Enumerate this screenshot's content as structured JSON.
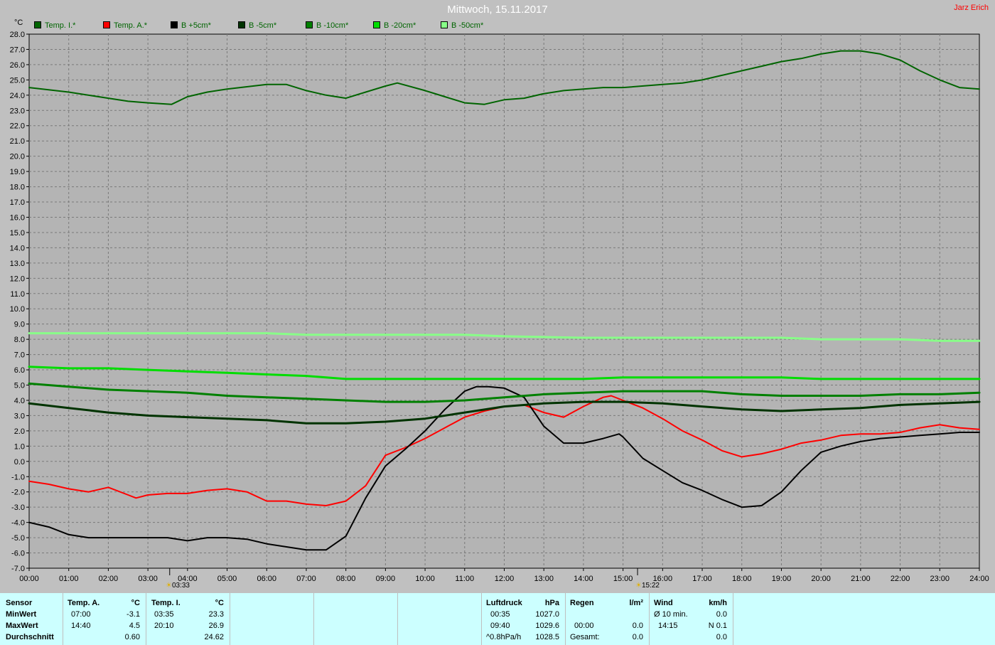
{
  "title": "Mittwoch, 15.11.2017",
  "author": "Jarz Erich",
  "unit_label": "°C",
  "legend": [
    {
      "label": "Temp. I.*",
      "color": "#006400"
    },
    {
      "label": "Temp. A.*",
      "color": "#ff0000"
    },
    {
      "label": "B +5cm*",
      "color": "#000000"
    },
    {
      "label": "B -5cm*",
      "color": "#003300"
    },
    {
      "label": "B -10cm*",
      "color": "#008000"
    },
    {
      "label": "B -20cm*",
      "color": "#00dd00"
    },
    {
      "label": "B -50cm*",
      "color": "#88ff88"
    }
  ],
  "sunrise": "03:33",
  "sunset": "15:22",
  "chart_data": {
    "type": "line",
    "title": "Mittwoch, 15.11.2017",
    "ylabel": "°C",
    "ylim": [
      -7.0,
      28.0
    ],
    "ytick_step": 1.0,
    "xlim": [
      0,
      24
    ],
    "x_ticks": [
      "00:00",
      "01:00",
      "02:00",
      "03:00",
      "04:00",
      "05:00",
      "06:00",
      "07:00",
      "08:00",
      "09:00",
      "10:00",
      "11:00",
      "12:00",
      "13:00",
      "14:00",
      "15:00",
      "16:00",
      "17:00",
      "18:00",
      "19:00",
      "20:00",
      "21:00",
      "22:00",
      "23:00",
      "24:00"
    ],
    "grid": true,
    "legend_position": "top-left",
    "series": [
      {
        "name": "Temp. I.*",
        "color": "#006400",
        "width": 2,
        "points": [
          [
            0,
            24.5
          ],
          [
            1,
            24.2
          ],
          [
            2,
            23.8
          ],
          [
            2.5,
            23.6
          ],
          [
            3,
            23.5
          ],
          [
            3.6,
            23.4
          ],
          [
            4,
            23.9
          ],
          [
            4.5,
            24.2
          ],
          [
            5,
            24.4
          ],
          [
            6,
            24.7
          ],
          [
            6.5,
            24.7
          ],
          [
            7,
            24.3
          ],
          [
            7.5,
            24.0
          ],
          [
            8,
            23.8
          ],
          [
            8.5,
            24.2
          ],
          [
            9,
            24.6
          ],
          [
            9.3,
            24.8
          ],
          [
            10,
            24.3
          ],
          [
            10.5,
            23.9
          ],
          [
            11,
            23.5
          ],
          [
            11.5,
            23.4
          ],
          [
            12,
            23.7
          ],
          [
            12.5,
            23.8
          ],
          [
            13,
            24.1
          ],
          [
            13.5,
            24.3
          ],
          [
            14,
            24.4
          ],
          [
            14.5,
            24.5
          ],
          [
            15,
            24.5
          ],
          [
            16,
            24.7
          ],
          [
            16.5,
            24.8
          ],
          [
            17,
            25.0
          ],
          [
            17.5,
            25.3
          ],
          [
            18,
            25.6
          ],
          [
            18.5,
            25.9
          ],
          [
            19,
            26.2
          ],
          [
            19.5,
            26.4
          ],
          [
            20,
            26.7
          ],
          [
            20.5,
            26.9
          ],
          [
            21,
            26.9
          ],
          [
            21.5,
            26.7
          ],
          [
            22,
            26.3
          ],
          [
            22.5,
            25.6
          ],
          [
            23,
            25.0
          ],
          [
            23.5,
            24.5
          ],
          [
            24,
            24.4
          ]
        ]
      },
      {
        "name": "Temp. A.*",
        "color": "#ff0000",
        "width": 2,
        "points": [
          [
            0,
            -1.3
          ],
          [
            0.5,
            -1.5
          ],
          [
            1,
            -1.8
          ],
          [
            1.5,
            -2.0
          ],
          [
            2,
            -1.7
          ],
          [
            2.5,
            -2.2
          ],
          [
            2.7,
            -2.4
          ],
          [
            3,
            -2.2
          ],
          [
            3.5,
            -2.1
          ],
          [
            4,
            -2.1
          ],
          [
            4.5,
            -1.9
          ],
          [
            5,
            -1.8
          ],
          [
            5.5,
            -2.0
          ],
          [
            6,
            -2.6
          ],
          [
            6.5,
            -2.6
          ],
          [
            7,
            -2.8
          ],
          [
            7.5,
            -2.9
          ],
          [
            8,
            -2.6
          ],
          [
            8.5,
            -1.6
          ],
          [
            9,
            0.4
          ],
          [
            9.5,
            0.9
          ],
          [
            10,
            1.5
          ],
          [
            10.5,
            2.2
          ],
          [
            11,
            2.9
          ],
          [
            11.5,
            3.3
          ],
          [
            12,
            3.6
          ],
          [
            12.5,
            3.7
          ],
          [
            13,
            3.2
          ],
          [
            13.5,
            2.9
          ],
          [
            14,
            3.6
          ],
          [
            14.5,
            4.2
          ],
          [
            14.7,
            4.3
          ],
          [
            15,
            4.0
          ],
          [
            15.5,
            3.5
          ],
          [
            16,
            2.8
          ],
          [
            16.5,
            2.0
          ],
          [
            17,
            1.4
          ],
          [
            17.5,
            0.7
          ],
          [
            18,
            0.3
          ],
          [
            18.5,
            0.5
          ],
          [
            19,
            0.8
          ],
          [
            19.5,
            1.2
          ],
          [
            20,
            1.4
          ],
          [
            20.5,
            1.7
          ],
          [
            21,
            1.8
          ],
          [
            21.5,
            1.8
          ],
          [
            22,
            1.9
          ],
          [
            22.5,
            2.2
          ],
          [
            23,
            2.4
          ],
          [
            23.5,
            2.2
          ],
          [
            24,
            2.1
          ]
        ]
      },
      {
        "name": "B +5cm*",
        "color": "#000000",
        "width": 2,
        "points": [
          [
            0,
            -4.0
          ],
          [
            0.5,
            -4.3
          ],
          [
            1,
            -4.8
          ],
          [
            1.5,
            -5.0
          ],
          [
            2,
            -5.0
          ],
          [
            2.5,
            -5.0
          ],
          [
            3,
            -5.0
          ],
          [
            3.5,
            -5.0
          ],
          [
            4,
            -5.2
          ],
          [
            4.5,
            -5.0
          ],
          [
            5,
            -5.0
          ],
          [
            5.5,
            -5.1
          ],
          [
            6,
            -5.4
          ],
          [
            6.5,
            -5.6
          ],
          [
            7,
            -5.8
          ],
          [
            7.5,
            -5.8
          ],
          [
            8,
            -4.9
          ],
          [
            8.5,
            -2.4
          ],
          [
            9,
            -0.3
          ],
          [
            9.5,
            0.8
          ],
          [
            10,
            2.0
          ],
          [
            10.5,
            3.4
          ],
          [
            11,
            4.6
          ],
          [
            11.3,
            4.9
          ],
          [
            11.6,
            4.9
          ],
          [
            12,
            4.8
          ],
          [
            12.5,
            4.2
          ],
          [
            13,
            2.3
          ],
          [
            13.5,
            1.2
          ],
          [
            14,
            1.2
          ],
          [
            14.5,
            1.5
          ],
          [
            14.9,
            1.8
          ],
          [
            15,
            1.6
          ],
          [
            15.5,
            0.2
          ],
          [
            16,
            -0.6
          ],
          [
            16.5,
            -1.4
          ],
          [
            17,
            -1.9
          ],
          [
            17.5,
            -2.5
          ],
          [
            18,
            -3.0
          ],
          [
            18.5,
            -2.9
          ],
          [
            19,
            -2.0
          ],
          [
            19.5,
            -0.6
          ],
          [
            20,
            0.6
          ],
          [
            20.5,
            1.0
          ],
          [
            21,
            1.3
          ],
          [
            21.5,
            1.5
          ],
          [
            22,
            1.6
          ],
          [
            22.5,
            1.7
          ],
          [
            23,
            1.8
          ],
          [
            23.5,
            1.9
          ],
          [
            24,
            1.9
          ]
        ]
      },
      {
        "name": "B -5cm*",
        "color": "#003300",
        "width": 3,
        "points": [
          [
            0,
            3.8
          ],
          [
            1,
            3.5
          ],
          [
            2,
            3.2
          ],
          [
            3,
            3.0
          ],
          [
            4,
            2.9
          ],
          [
            5,
            2.8
          ],
          [
            6,
            2.7
          ],
          [
            7,
            2.5
          ],
          [
            8,
            2.5
          ],
          [
            9,
            2.6
          ],
          [
            10,
            2.8
          ],
          [
            11,
            3.2
          ],
          [
            12,
            3.6
          ],
          [
            13,
            3.8
          ],
          [
            14,
            3.9
          ],
          [
            15,
            3.9
          ],
          [
            16,
            3.8
          ],
          [
            17,
            3.6
          ],
          [
            18,
            3.4
          ],
          [
            19,
            3.3
          ],
          [
            20,
            3.4
          ],
          [
            21,
            3.5
          ],
          [
            22,
            3.7
          ],
          [
            23,
            3.8
          ],
          [
            24,
            3.9
          ]
        ]
      },
      {
        "name": "B -10cm*",
        "color": "#008000",
        "width": 3,
        "points": [
          [
            0,
            5.1
          ],
          [
            1,
            4.9
          ],
          [
            2,
            4.7
          ],
          [
            3,
            4.6
          ],
          [
            4,
            4.5
          ],
          [
            5,
            4.3
          ],
          [
            6,
            4.2
          ],
          [
            7,
            4.1
          ],
          [
            8,
            4.0
          ],
          [
            9,
            3.9
          ],
          [
            10,
            3.9
          ],
          [
            11,
            4.0
          ],
          [
            12,
            4.2
          ],
          [
            13,
            4.4
          ],
          [
            14,
            4.5
          ],
          [
            15,
            4.6
          ],
          [
            16,
            4.6
          ],
          [
            17,
            4.6
          ],
          [
            18,
            4.4
          ],
          [
            19,
            4.3
          ],
          [
            20,
            4.3
          ],
          [
            21,
            4.3
          ],
          [
            22,
            4.4
          ],
          [
            23,
            4.4
          ],
          [
            24,
            4.5
          ]
        ]
      },
      {
        "name": "B -20cm*",
        "color": "#00dd00",
        "width": 3,
        "points": [
          [
            0,
            6.2
          ],
          [
            1,
            6.1
          ],
          [
            2,
            6.1
          ],
          [
            3,
            6.0
          ],
          [
            4,
            5.9
          ],
          [
            5,
            5.8
          ],
          [
            6,
            5.7
          ],
          [
            7,
            5.6
          ],
          [
            8,
            5.4
          ],
          [
            9,
            5.4
          ],
          [
            10,
            5.4
          ],
          [
            11,
            5.4
          ],
          [
            12,
            5.4
          ],
          [
            13,
            5.4
          ],
          [
            14,
            5.4
          ],
          [
            15,
            5.5
          ],
          [
            16,
            5.5
          ],
          [
            17,
            5.5
          ],
          [
            18,
            5.5
          ],
          [
            19,
            5.5
          ],
          [
            20,
            5.4
          ],
          [
            21,
            5.4
          ],
          [
            22,
            5.4
          ],
          [
            23,
            5.4
          ],
          [
            24,
            5.4
          ]
        ]
      },
      {
        "name": "B -50cm*",
        "color": "#88ff88",
        "width": 3,
        "points": [
          [
            0,
            8.4
          ],
          [
            2,
            8.4
          ],
          [
            4,
            8.4
          ],
          [
            6,
            8.4
          ],
          [
            7,
            8.3
          ],
          [
            8,
            8.3
          ],
          [
            10,
            8.3
          ],
          [
            11,
            8.3
          ],
          [
            12,
            8.2
          ],
          [
            14,
            8.1
          ],
          [
            16,
            8.1
          ],
          [
            18,
            8.1
          ],
          [
            19,
            8.1
          ],
          [
            20,
            8.0
          ],
          [
            21,
            8.0
          ],
          [
            22,
            8.0
          ],
          [
            23,
            7.9
          ],
          [
            24,
            7.9
          ]
        ]
      }
    ]
  },
  "stats": {
    "sensor": {
      "header": "Sensor",
      "min": "MinWert",
      "max": "MaxWert",
      "avg": "Durchschnitt"
    },
    "temp_a": {
      "header": "Temp. A.",
      "unit": "°C",
      "min_time": "07:00",
      "min_val": "-3.1",
      "max_time": "14:40",
      "max_val": "4.5",
      "avg_val": "0.60"
    },
    "temp_i": {
      "header": "Temp. I.",
      "unit": "°C",
      "min_time": "03:35",
      "min_val": "23.3",
      "max_time": "20:10",
      "max_val": "26.9",
      "avg_val": "24.62"
    },
    "pressure": {
      "header": "Luftdruck",
      "unit": "hPa",
      "min_time": "00:35",
      "min_val": "1027.0",
      "max_time": "09:40",
      "max_val": "1029.6",
      "trend_label": "^0.8hPa/h",
      "trend_val": "1028.5"
    },
    "rain": {
      "header": "Regen",
      "unit": "l/m²",
      "max_time": "00:00",
      "max_val": "0.0",
      "total_label": "Gesamt:",
      "total_val": "0.0"
    },
    "wind": {
      "header": "Wind",
      "unit": "km/h",
      "avg_label": "Ø 10 min.",
      "avg_val": "0.0",
      "max_time": "14:15",
      "max_val": "N 0.1",
      "extra_val": "0.0"
    }
  }
}
